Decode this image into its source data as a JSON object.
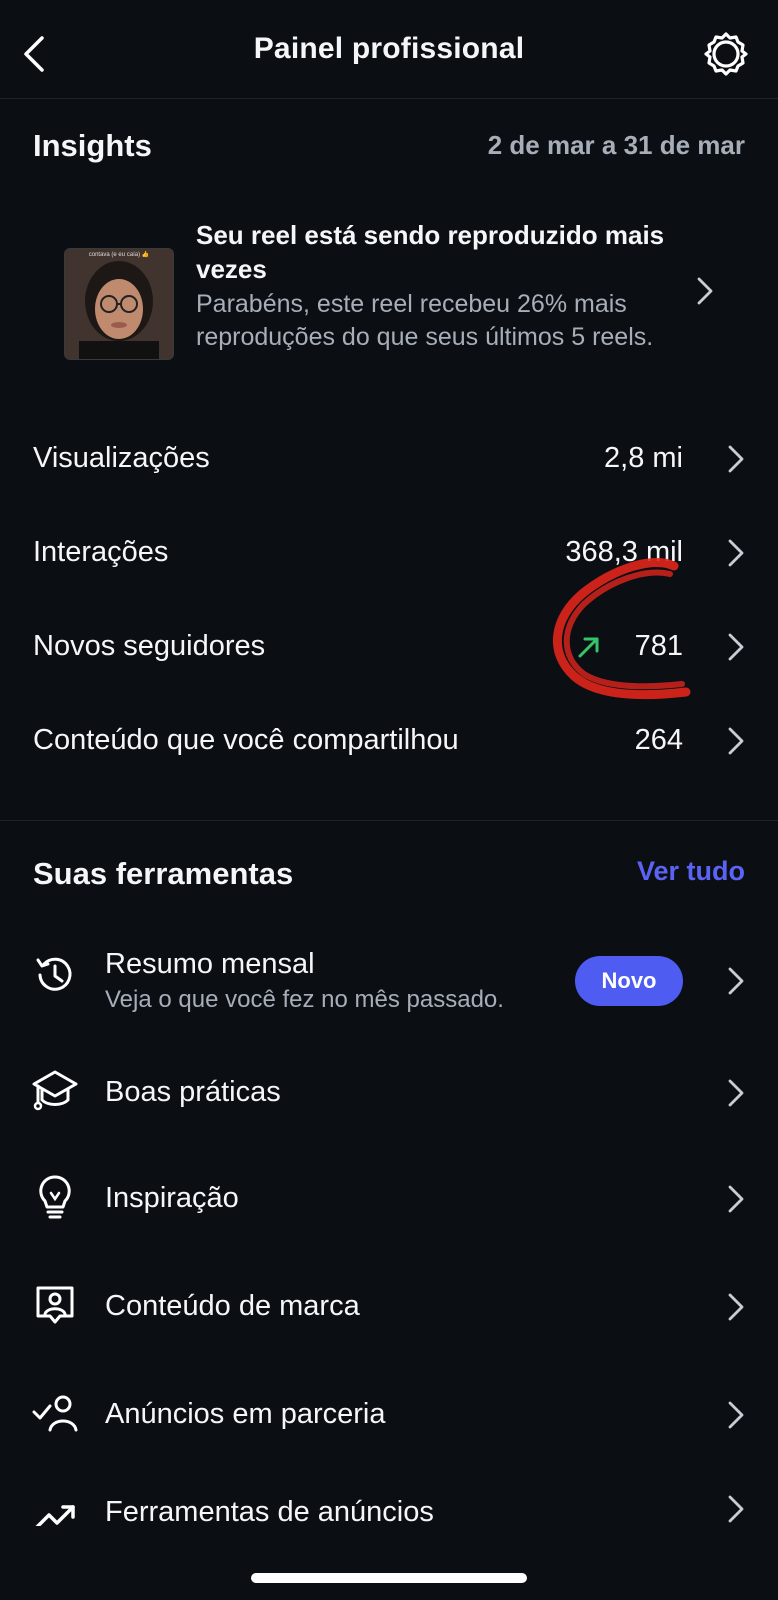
{
  "header": {
    "title": "Painel profissional"
  },
  "insights": {
    "heading": "Insights",
    "date_range": "2 de mar a 31 de mar",
    "reel_card": {
      "thumb_caption": "contava (e eu caía) 👍",
      "title": "Seu reel está sendo reproduzido mais vezes",
      "description": "Parabéns, este reel recebeu 26% mais reproduções do que seus últimos 5 reels."
    },
    "metrics": [
      {
        "label": "Visualizações",
        "value": "2,8 mi"
      },
      {
        "label": "Interações",
        "value": "368,3 mil"
      },
      {
        "label": "Novos seguidores",
        "value": "781"
      },
      {
        "label": "Conteúdo que você compartilhou",
        "value": "264"
      }
    ]
  },
  "tools": {
    "heading": "Suas ferramentas",
    "see_all": "Ver tudo",
    "items": [
      {
        "label": "Resumo mensal",
        "subtitle": "Veja o que você fez no mês passado.",
        "badge": "Novo",
        "icon": "history-icon"
      },
      {
        "label": "Boas práticas",
        "icon": "graduation-cap-icon"
      },
      {
        "label": "Inspiração",
        "icon": "lightbulb-icon"
      },
      {
        "label": "Conteúdo de marca",
        "icon": "branded-content-icon"
      },
      {
        "label": "Anúncios em parceria",
        "icon": "partner-ads-icon"
      },
      {
        "label": "Ferramentas de anúncios",
        "icon": "trending-up-icon"
      }
    ]
  },
  "colors": {
    "background": "#0b0f14",
    "accent": "#5b63f5",
    "badge": "#4f5cf2",
    "trend_up": "#35c46a",
    "annotation": "#e0261b",
    "muted": "#a7aeb8"
  }
}
